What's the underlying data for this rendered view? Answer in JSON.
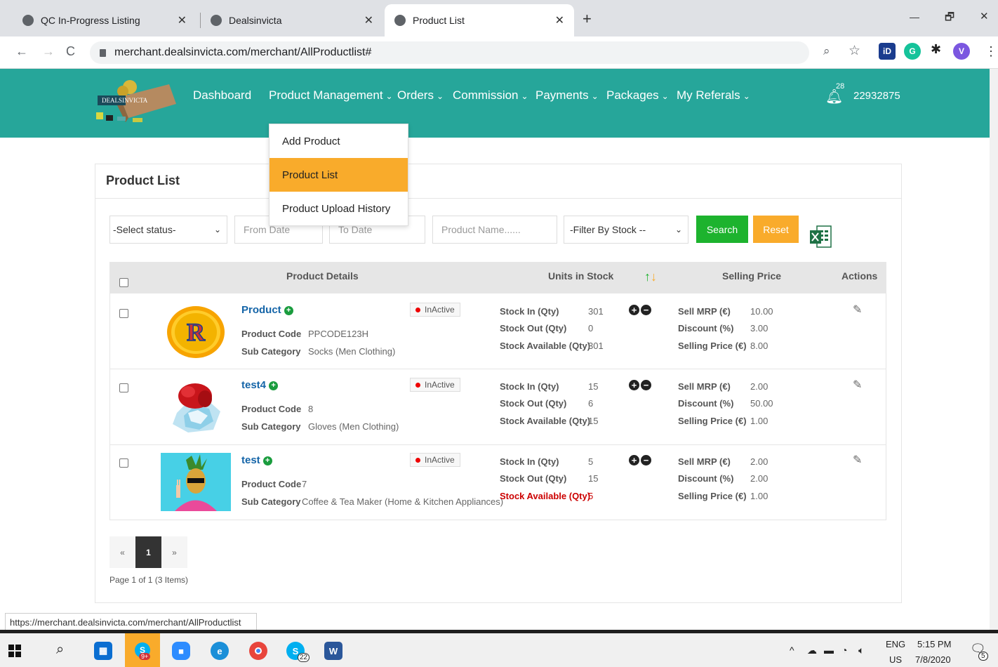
{
  "browser": {
    "tabs": [
      {
        "title": "QC In-Progress Listing"
      },
      {
        "title": "Dealsinvicta"
      },
      {
        "title": "Product List"
      }
    ],
    "new_tab": "+",
    "url": "merchant.dealsinvicta.com/merchant/AllProductlist#",
    "status_url": "https://merchant.dealsinvicta.com/merchant/AllProductlist",
    "profile_initial": "V",
    "window_controls": {
      "min": "—",
      "max": "🗗",
      "close": "✕"
    }
  },
  "header": {
    "logo_text": "DEALSINVICTA",
    "nav": [
      "Dashboard",
      "Product Management",
      "Orders",
      "Commission",
      "Payments",
      "Packages",
      "My Referals"
    ],
    "notif_count": "28",
    "user_id": "22932875",
    "dropdown": [
      "Add Product",
      "Product List",
      "Product Upload History"
    ]
  },
  "panel": {
    "title": "Product List",
    "filters": {
      "status": "-Select status-",
      "from_date": "From Date",
      "to_date": "To Date",
      "product_name": "Product Name......",
      "stock": "-Filter By Stock --",
      "search": "Search",
      "reset": "Reset"
    },
    "columns": {
      "details": "Product Details",
      "stock": "Units in Stock",
      "price": "Selling Price",
      "actions": "Actions"
    },
    "labels": {
      "code": "Product Code",
      "subcat": "Sub Category",
      "stock_in": "Stock In (Qty)",
      "stock_out": "Stock Out (Qty)",
      "stock_avail": "Stock Available (Qty)",
      "mrp": "Sell MRP (€)",
      "discount": "Discount (%)",
      "selling": "Selling Price (€)"
    },
    "products": [
      {
        "name": "Product",
        "status": "InActive",
        "code": "PPCODE123H",
        "subcat": "Socks (Men Clothing)",
        "stock_in": "301",
        "stock_out": "0",
        "stock_avail": "301",
        "mrp": "10.00",
        "discount": "3.00",
        "selling": "8.00"
      },
      {
        "name": "test4",
        "status": "InActive",
        "code": "8",
        "subcat": "Gloves (Men Clothing)",
        "stock_in": "15",
        "stock_out": "6",
        "stock_avail": "15",
        "mrp": "2.00",
        "discount": "50.00",
        "selling": "1.00"
      },
      {
        "name": "test",
        "status": "InActive",
        "code": "7",
        "subcat": "Coffee & Tea Maker (Home & Kitchen Appliances)",
        "stock_in": "5",
        "stock_out": "15",
        "stock_avail": "5",
        "mrp": "2.00",
        "discount": "2.00",
        "selling": "1.00"
      }
    ],
    "pagination": {
      "prev": "«",
      "current": "1",
      "next": "»",
      "summary": "Page 1 of 1 (3 Items)"
    }
  },
  "taskbar": {
    "lang": "ENG",
    "region": "US",
    "time": "5:15 PM",
    "date": "7/8/2020",
    "badge_skype1": "9+",
    "badge_skype2": "22",
    "notif_count": "5"
  }
}
